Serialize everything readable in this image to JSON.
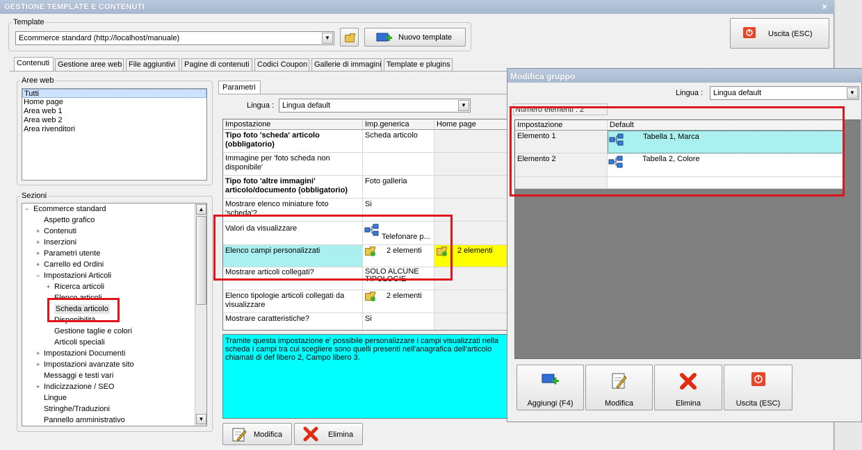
{
  "window": {
    "title": "GESTIONE TEMPLATE E CONTENUTI",
    "close": "×"
  },
  "template": {
    "legend": "Template",
    "selected": "Ecommerce standard (http://localhost/manuale)",
    "new_button": "Nuovo template"
  },
  "exit_button": "Uscita (ESC)",
  "tabs": [
    {
      "label": "Contenuti"
    },
    {
      "label": "Gestione aree web"
    },
    {
      "label": "File aggiuntivi"
    },
    {
      "label": "Pagine di contenuti"
    },
    {
      "label": "Codici Coupon"
    },
    {
      "label": "Gallerie di immagini"
    },
    {
      "label": "Template e plugins"
    }
  ],
  "aree_web": {
    "legend": "Aree web",
    "items": [
      "Tutti",
      "Home page",
      "Area web 1",
      "Area web 2",
      "Area rivenditori"
    ]
  },
  "sezioni": {
    "legend": "Sezioni",
    "items": [
      {
        "label": "Ecommerce standard",
        "exp": "−"
      },
      {
        "label": "Aspetto grafico",
        "exp": ""
      },
      {
        "label": "Contenuti",
        "exp": "+"
      },
      {
        "label": "Inserzioni",
        "exp": "+"
      },
      {
        "label": "Parametri utente",
        "exp": "+"
      },
      {
        "label": "Carrello ed Ordini",
        "exp": "+"
      },
      {
        "label": "Impostazioni Articoli",
        "exp": "−"
      },
      {
        "label": "Ricerca articoli",
        "exp": "+"
      },
      {
        "label": "Elenco articoli",
        "exp": ""
      },
      {
        "label": "Scheda articolo",
        "exp": ""
      },
      {
        "label": "Disponibilità",
        "exp": ""
      },
      {
        "label": "Gestione taglie e colori",
        "exp": ""
      },
      {
        "label": "Articoli speciali",
        "exp": ""
      },
      {
        "label": "Impostazioni Documenti",
        "exp": "+"
      },
      {
        "label": "Impostazioni avanzate sito",
        "exp": "+"
      },
      {
        "label": "Messaggi e testi vari",
        "exp": ""
      },
      {
        "label": "Indicizzazione / SEO",
        "exp": "+"
      },
      {
        "label": "Lingue",
        "exp": ""
      },
      {
        "label": "Stringhe/Traduzioni",
        "exp": ""
      },
      {
        "label": "Pannello amministrativo",
        "exp": ""
      }
    ]
  },
  "parametri": {
    "tab": "Parametri",
    "lingua_label": "Lingua :",
    "lingua_value": "Lingua default",
    "columns": [
      "Impostazione",
      "Imp.generica",
      "Home page"
    ],
    "rows": [
      {
        "name": "Tipo foto 'scheda' articolo (obbligatorio)",
        "gen": "Scheda articolo",
        "home": ""
      },
      {
        "name": "Immagine per 'foto scheda non disponibile'",
        "gen": "",
        "home": ""
      },
      {
        "name": "Tipo foto 'altre immagini' articolo/documento (obbligatorio)",
        "gen": "Foto galleria",
        "home": ""
      },
      {
        "name": "Mostrare elenco miniature foto 'scheda'?",
        "gen": "Si",
        "home": ""
      },
      {
        "name": "Valori da visualizzare",
        "gen": "Telefonare p...",
        "home": ""
      },
      {
        "name": "Elenco campi personalizzati",
        "gen": "2 elementi",
        "home": "2 elementi"
      },
      {
        "name": "Mostrare articoli collegati?",
        "gen": "SOLO ALCUNE TIPOLOGIE",
        "home": ""
      },
      {
        "name": "Elenco tipologie articoli collegati da visualizzare",
        "gen": "2 elementi",
        "home": ""
      },
      {
        "name": "Mostrare caratteristiche?",
        "gen": "Si",
        "home": ""
      }
    ],
    "description": "Tramite questa impostazione e' possibile personalizzare i campi visualizzati nella scheda I campi tra cui scegliere sono quelli presenti nell'anagrafica dell'articolo chiamati di def libero 2, Campo libero 3.",
    "modifica": "Modifica",
    "elimina": "Elimina"
  },
  "dialog": {
    "title": "Modifica gruppo",
    "lingua_label": "Lingua :",
    "lingua_value": "Lingua default",
    "count_label": "Numero elementi : 2",
    "columns": [
      "Impostazione",
      "Default"
    ],
    "rows": [
      {
        "name": "Elemento 1",
        "value": "Tabella 1, Marca"
      },
      {
        "name": "Elemento 2",
        "value": "Tabella 2, Colore"
      }
    ],
    "buttons": {
      "add": "Aggiungi (F4)",
      "edit": "Modifica",
      "delete": "Elimina",
      "exit": "Uscita (ESC)"
    }
  },
  "colors": {
    "cyan": "#00ffff",
    "selected_cell": "#aaf0f0",
    "yellow": "#ffff00",
    "highlight_red": "#e0151b",
    "dark_area": "#808080"
  }
}
